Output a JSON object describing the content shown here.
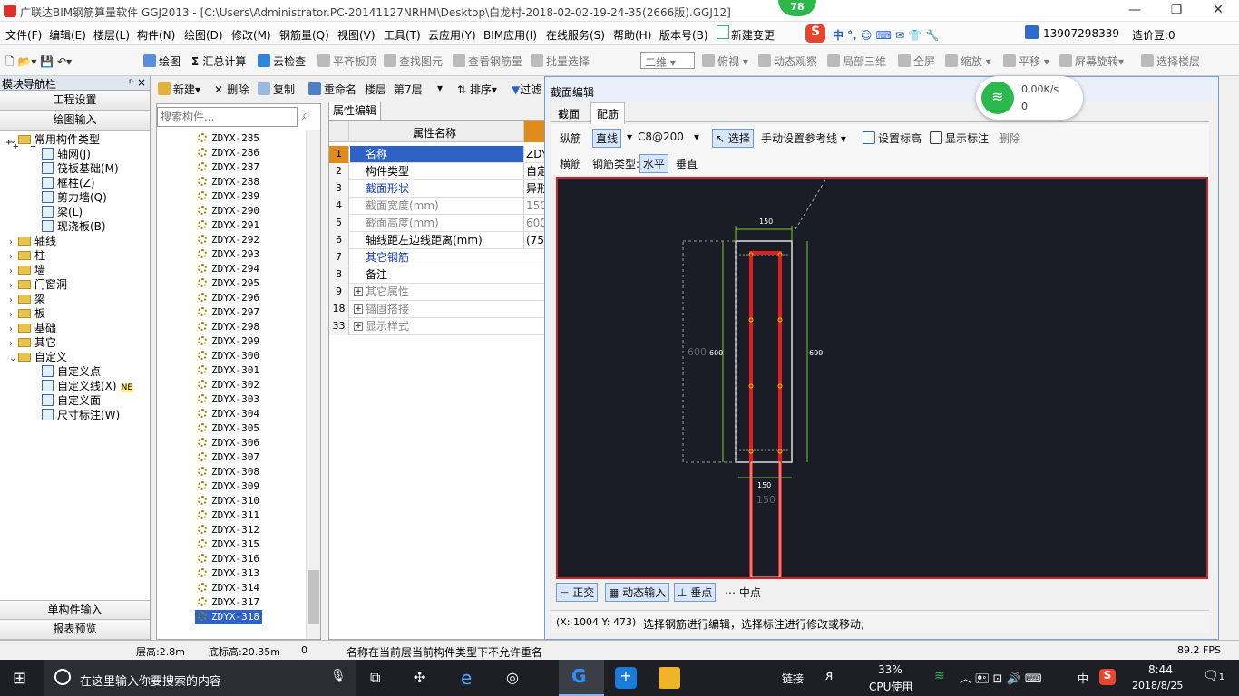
{
  "title_bar": {
    "title": "广联达BIM钢筋算量软件 GGJ2013 - [C:\\Users\\Administrator.PC-20141127NRHM\\Desktop\\白龙村-2018-02-02-19-24-35(2666版).GGJ12]",
    "minimize": "—",
    "restore": "❐",
    "close": "✕"
  },
  "badge": "78",
  "menu": [
    "文件(F)",
    "编辑(E)",
    "楼层(L)",
    "构件(N)",
    "绘图(D)",
    "修改(M)",
    "钢筋量(Q)",
    "视图(V)",
    "工具(T)",
    "云应用(Y)",
    "BIM应用(I)",
    "在线服务(S)",
    "帮助(H)",
    "版本号(B)",
    "新建变更",
    "13907298339",
    "造价豆:0"
  ],
  "toolbar": [
    "绘图",
    "汇总计算",
    "云检查",
    "平齐板顶",
    "查找图元",
    "查看钢筋量",
    "批量选择",
    "二维",
    "俯视",
    "动态观察",
    "局部三维",
    "全屏",
    "缩放",
    "平移",
    "屏幕旋转",
    "选择楼层"
  ],
  "nav": {
    "header": "模块导航栏",
    "pin": "ᵖ ×",
    "btn_project": "工程设置",
    "btn_draw": "绘图输入",
    "btn_single": "单构件输入",
    "btn_report": "报表预览",
    "tree": [
      {
        "label": "常用构件类型",
        "level": 0,
        "open": true
      },
      {
        "label": "轴网(J)",
        "level": 1
      },
      {
        "label": "筏板基础(M)",
        "level": 1
      },
      {
        "label": "框柱(Z)",
        "level": 1
      },
      {
        "label": "剪力墙(Q)",
        "level": 1
      },
      {
        "label": "梁(L)",
        "level": 1
      },
      {
        "label": "现浇板(B)",
        "level": 1
      },
      {
        "label": "轴线",
        "level": 0
      },
      {
        "label": "柱",
        "level": 0
      },
      {
        "label": "墙",
        "level": 0
      },
      {
        "label": "门窗洞",
        "level": 0
      },
      {
        "label": "梁",
        "level": 0
      },
      {
        "label": "板",
        "level": 0
      },
      {
        "label": "基础",
        "level": 0
      },
      {
        "label": "其它",
        "level": 0
      },
      {
        "label": "自定义",
        "level": 0,
        "open": true
      },
      {
        "label": "自定义点",
        "level": 1
      },
      {
        "label": "自定义线(X)",
        "level": 1,
        "tag": "NE"
      },
      {
        "label": "自定义面",
        "level": 1
      },
      {
        "label": "尺寸标注(W)",
        "level": 1
      }
    ]
  },
  "list_toolbar": {
    "new": "新建",
    "delete": "删除",
    "copy": "复制",
    "rename": "重命名",
    "floor_label": "楼层",
    "floor": "第7层",
    "sort": "排序",
    "filter": "过滤"
  },
  "search_placeholder": "搜索构件...",
  "components": [
    "ZDYX-285",
    "ZDYX-286",
    "ZDYX-287",
    "ZDYX-288",
    "ZDYX-289",
    "ZDYX-290",
    "ZDYX-291",
    "ZDYX-292",
    "ZDYX-293",
    "ZDYX-294",
    "ZDYX-295",
    "ZDYX-296",
    "ZDYX-297",
    "ZDYX-298",
    "ZDYX-299",
    "ZDYX-300",
    "ZDYX-301",
    "ZDYX-302",
    "ZDYX-303",
    "ZDYX-304",
    "ZDYX-305",
    "ZDYX-306",
    "ZDYX-307",
    "ZDYX-308",
    "ZDYX-309",
    "ZDYX-310",
    "ZDYX-311",
    "ZDYX-312",
    "ZDYX-315",
    "ZDYX-316",
    "ZDYX-313",
    "ZDYX-314",
    "ZDYX-317",
    "ZDYX-318"
  ],
  "props": {
    "tab": "属性编辑",
    "header": "属性名称",
    "rows": [
      {
        "n": "1",
        "k": "名称",
        "v": "ZDYX",
        "sel": true
      },
      {
        "n": "2",
        "k": "构件类型",
        "v": "自定"
      },
      {
        "n": "3",
        "k": "截面形状",
        "v": "异形",
        "blue": true
      },
      {
        "n": "4",
        "k": "截面宽度(mm)",
        "v": "150",
        "gray": true
      },
      {
        "n": "5",
        "k": "截面高度(mm)",
        "v": "600",
        "gray": true
      },
      {
        "n": "6",
        "k": "轴线距左边线距离(mm)",
        "v": "(75)"
      },
      {
        "n": "7",
        "k": "其它钢筋",
        "v": "",
        "blue": true
      },
      {
        "n": "8",
        "k": "备注",
        "v": ""
      },
      {
        "n": "9",
        "k": "其它属性",
        "v": "",
        "plus": true,
        "gray": true
      },
      {
        "n": "18",
        "k": "锚固搭接",
        "v": "",
        "plus": true,
        "gray": true
      },
      {
        "n": "33",
        "k": "显示样式",
        "v": "",
        "plus": true,
        "gray": true
      }
    ]
  },
  "dialog": {
    "title": "截面编辑",
    "tab1": "截面",
    "tab2": "配筋",
    "r1": {
      "zongjin": "纵筋",
      "line": "直线",
      "spec": "C8@200",
      "select": "选择",
      "manual": "手动设置参考线",
      "elev": "设置标高",
      "show": "显示标注",
      "del": "删除"
    },
    "r2": {
      "hengjin": "横筋",
      "type_label": "钢筋类型:",
      "horizontal": "水平",
      "vertical": "垂直"
    },
    "dims": {
      "w_top": "150",
      "h_right": "600",
      "h_left": "600",
      "h_left_gray": "600",
      "w_bottom": "150",
      "w_bottom_gray": "150"
    },
    "bottom": {
      "ortho": "正交",
      "dyn": "动态输入",
      "perp": "垂点",
      "mid": "中点"
    },
    "coords": "(X: 1004 Y: 473)",
    "hint": "选择钢筋进行编辑，选择标注进行修改或移动;"
  },
  "wifi": {
    "speed": "0.00K/s",
    "count": "0"
  },
  "status": {
    "floor_h": "层高:2.8m",
    "bottom_h": "底标高:20.35m",
    "zero": "0",
    "msg": "名称在当前层当前构件类型下不允许重名",
    "fps": "89.2 FPS"
  },
  "taskbar": {
    "search": "在这里输入你要搜索的内容",
    "link": "链接",
    "cpu_pct": "33%",
    "cpu": "CPU使用",
    "ime": "中",
    "time": "8:44",
    "date": "2018/8/25",
    "notif": "1"
  }
}
